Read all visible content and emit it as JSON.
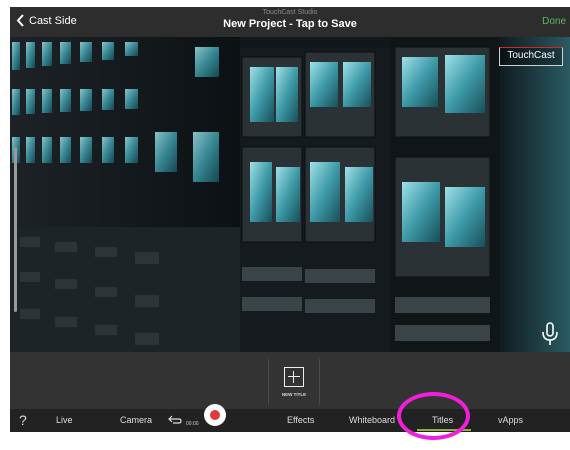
{
  "topbar": {
    "back_label": "Cast Side",
    "studio_label": "TouchCast Studio",
    "project_title": "New Project - Tap to Save",
    "done_label": "Done"
  },
  "video": {
    "brand_label": "TouchCast"
  },
  "titles_panel": {
    "new_title_label": "NEW TITLE"
  },
  "toolbar": {
    "help_label": "?",
    "live_label": "Live",
    "camera_label": "Camera",
    "timer": "00:00",
    "effects_label": "Effects",
    "whiteboard_label": "Whiteboard",
    "titles_label": "Titles",
    "vapps_label": "vApps",
    "active_tab": "Titles"
  },
  "colors": {
    "done": "#5db85c",
    "record": "#e23b3b",
    "active_tab_underline": "#8fb03a",
    "annotation_circle": "#f020d8"
  }
}
